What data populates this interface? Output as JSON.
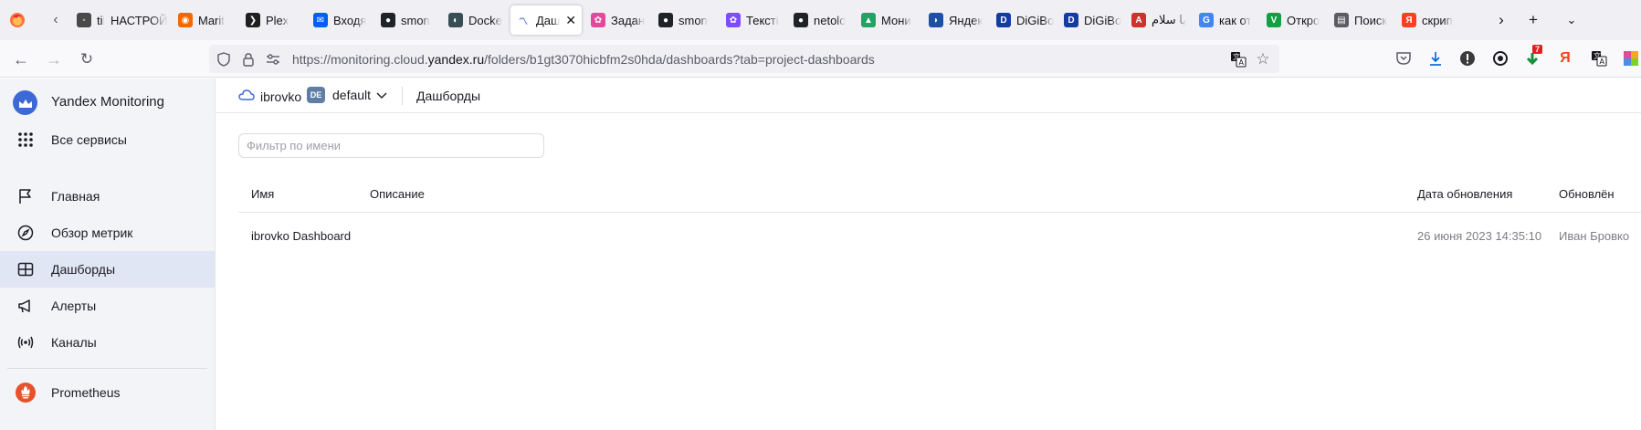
{
  "tabs": [
    {
      "title": "tik U",
      "color": "#4a4a4a",
      "glyph": "◦"
    },
    {
      "title": "НАСТРОЙ",
      "color": "#ffffff",
      "glyph": ""
    },
    {
      "title": "Marit",
      "color": "#f46800",
      "glyph": "◉"
    },
    {
      "title": "Plex",
      "color": "#1f1f1f",
      "glyph": "❯"
    },
    {
      "title": "Входя",
      "color": "#005ff9",
      "glyph": "✉"
    },
    {
      "title": "smon",
      "color": "#1f2328",
      "glyph": "●"
    },
    {
      "title": "Docke",
      "color": "#394d54",
      "glyph": "◐"
    },
    {
      "title": "Даш",
      "color": "#ffffff",
      "glyph": "〽"
    },
    {
      "title": "Задан",
      "color": "#e44a9b",
      "glyph": "✿"
    },
    {
      "title": "smon",
      "color": "#1f2328",
      "glyph": "●"
    },
    {
      "title": "Тексті",
      "color": "#7b4dff",
      "glyph": "✿"
    },
    {
      "title": "netolo",
      "color": "#1f2328",
      "glyph": "●"
    },
    {
      "title": "Мони",
      "color": "#1fa463",
      "glyph": "▲"
    },
    {
      "title": "Яндек",
      "color": "#1d4fa5",
      "glyph": "◗"
    },
    {
      "title": "DiGiBo",
      "color": "#143ba0",
      "glyph": "D"
    },
    {
      "title": "DiGiBo",
      "color": "#143ba0",
      "glyph": "D"
    },
    {
      "title": "یا سلام",
      "color": "#d0312d",
      "glyph": "A"
    },
    {
      "title": "как от",
      "color": "#4285f4",
      "glyph": "G"
    },
    {
      "title": "Откро",
      "color": "#11a042",
      "glyph": "V"
    },
    {
      "title": "Поиск",
      "color": "#5b5b66",
      "glyph": "▤"
    },
    {
      "title": "скрип",
      "color": "#fc3f1d",
      "glyph": "Я"
    }
  ],
  "address_bar": {
    "url_prefix": "https://monitoring.cloud.",
    "url_domain": "yandex.ru",
    "url_suffix": "/folders/b1gt3070hicbfm2s0hda/dashboards?tab=project-dashboards"
  },
  "toolbar": {
    "download_badge": "7"
  },
  "sidebar": {
    "brand": "Yandex Monitoring",
    "all_services": "Все сервисы",
    "items": [
      {
        "label": "Главная",
        "icon": "flag-icon"
      },
      {
        "label": "Обзор метрик",
        "icon": "compass-icon"
      },
      {
        "label": "Дашборды",
        "icon": "dashboard-icon",
        "active": true
      },
      {
        "label": "Алерты",
        "icon": "megaphone-icon"
      },
      {
        "label": "Каналы",
        "icon": "broadcast-icon"
      }
    ],
    "prometheus": "Prometheus"
  },
  "breadcrumb": {
    "cloud": "ibrovko",
    "folder_badge": "DE",
    "folder": "default",
    "section": "Дашборды"
  },
  "filter": {
    "placeholder": "Фильтр по имени",
    "value": ""
  },
  "table": {
    "columns": {
      "name": "Имя",
      "description": "Описание",
      "updated_at": "Дата обновления",
      "updated_by": "Обновлён"
    },
    "rows": [
      {
        "name": "ibrovko Dashboard",
        "description": "",
        "updated_at": "26 июня 2023 14:35:10",
        "updated_by": "Иван Бровко"
      }
    ]
  },
  "colors": {
    "accent": "#3d69d6",
    "active_nav": "#e1e6f5",
    "prometheus": "#e6522c"
  }
}
